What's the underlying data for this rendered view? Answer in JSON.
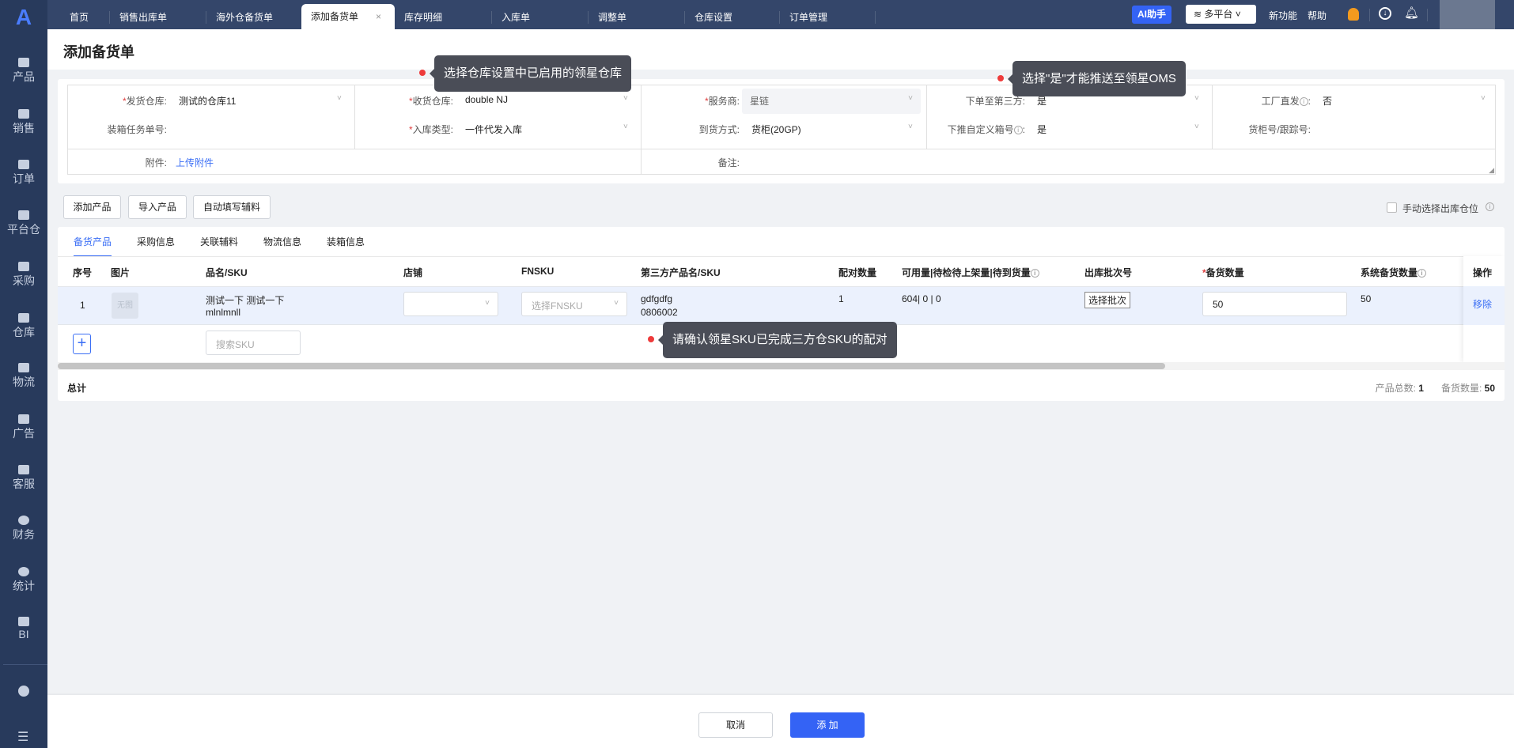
{
  "sidebar": {
    "items": [
      {
        "label": "产品"
      },
      {
        "label": "销售"
      },
      {
        "label": "订单"
      },
      {
        "label": "平台仓"
      },
      {
        "label": "采购"
      },
      {
        "label": "仓库"
      },
      {
        "label": "物流"
      },
      {
        "label": "广告"
      },
      {
        "label": "客服"
      },
      {
        "label": "财务"
      },
      {
        "label": "统计"
      },
      {
        "label": "BI"
      }
    ]
  },
  "tabs": [
    {
      "label": "首页"
    },
    {
      "label": "销售出库单"
    },
    {
      "label": "海外仓备货单"
    },
    {
      "label": "添加备货单",
      "close": "×"
    },
    {
      "label": "库存明细"
    },
    {
      "label": "入库单"
    },
    {
      "label": "调整单"
    },
    {
      "label": "仓库设置"
    },
    {
      "label": "订单管理"
    }
  ],
  "topbar": {
    "ai": "AI助手",
    "platform": "多平台",
    "new_features": "新功能",
    "help": "帮助"
  },
  "page_title": "添加备货单",
  "form": {
    "ship_wh_label": "发货仓库:",
    "ship_wh": "测试的仓库11",
    "packing_task_label": "装箱任务单号:",
    "recv_wh_label": "收货仓库:",
    "recv_wh": "double NJ",
    "inbound_type_label": "入库类型:",
    "inbound_type": "一件代发入库",
    "provider_label": "服务商:",
    "provider": "星链",
    "arrival_label": "到货方式:",
    "arrival": "货柜(20GP)",
    "third_party_label": "下单至第三方:",
    "third_party": "是",
    "custom_box_label": "下推自定义箱号",
    "custom_box": "是",
    "factory_label": "工厂直发",
    "factory": "否",
    "container_label": "货柜号/跟踪号:",
    "attach_label": "附件:",
    "attach_link": "上传附件",
    "remark_label": "备注:"
  },
  "actions": {
    "add_product": "添加产品",
    "import_product": "导入产品",
    "auto_fill": "自动填写辅料",
    "manual_loc": "手动选择出库仓位"
  },
  "detail_tabs": [
    {
      "label": "备货产品"
    },
    {
      "label": "采购信息"
    },
    {
      "label": "关联辅料"
    },
    {
      "label": "物流信息"
    },
    {
      "label": "装箱信息"
    }
  ],
  "table": {
    "headers": {
      "no": "序号",
      "img": "图片",
      "name": "品名/SKU",
      "shop": "店铺",
      "fnsku": "FNSKU",
      "third": "第三方产品名/SKU",
      "pair": "配对数量",
      "avail": "可用量|待检待上架量|待到货量",
      "batch": "出库批次号",
      "qty": "备货数量",
      "sys_qty": "系统备货数量",
      "op": "操作"
    },
    "rows": [
      {
        "no": "1",
        "img": "无图",
        "name": "测试一下 测试一下",
        "sku": "mlnlmnll",
        "fnsku_placeholder": "选择FNSKU",
        "third_name": "gdfgdfg",
        "third_sku": "0806002",
        "pair": "1",
        "avail": "604| 0 | 0",
        "batch_btn": "选择批次",
        "qty": "50",
        "sys_qty": "50",
        "op": "移除"
      }
    ],
    "search_placeholder": "搜索SKU",
    "total_label": "总计",
    "product_total_label": "产品总数:",
    "product_total": "1",
    "qty_total_label": "备货数量:",
    "qty_total": "50"
  },
  "tooltips": {
    "wh": "选择仓库设置中已启用的领星仓库",
    "oms": "选择\"是\"才能推送至领星OMS",
    "sku": "请确认领星SKU已完成三方仓SKU的配对"
  },
  "footer": {
    "cancel": "取消",
    "submit": "添 加"
  }
}
